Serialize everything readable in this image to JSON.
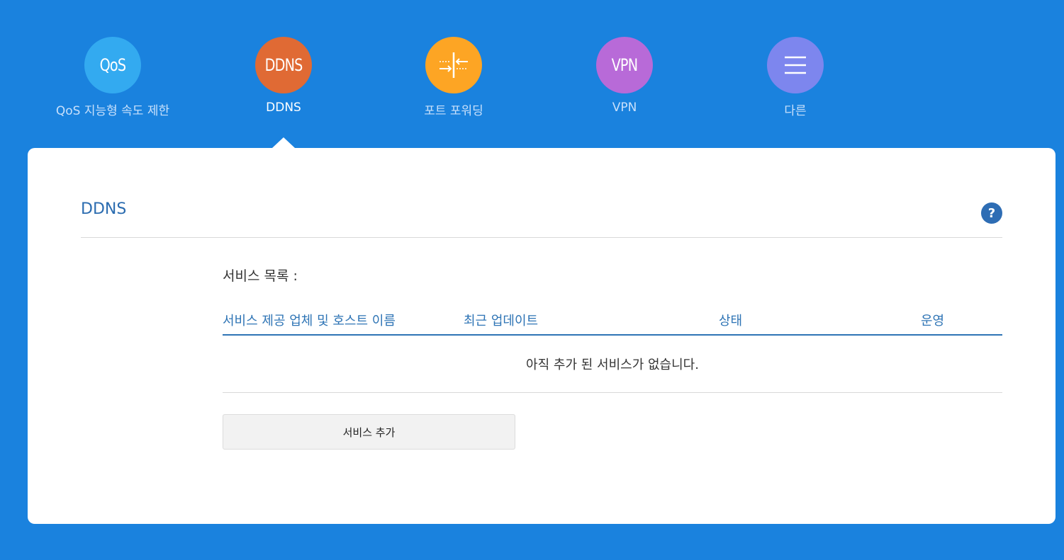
{
  "nav": {
    "items": [
      {
        "icon": "qos-icon",
        "icon_text": "QoS",
        "label": "QoS 지능형 속도 제한",
        "color": "#33aaf0",
        "active": false
      },
      {
        "icon": "ddns-icon",
        "icon_text": "DDNS",
        "label": "DDNS",
        "color": "#e06a34",
        "active": true
      },
      {
        "icon": "port-forwarding-icon",
        "icon_text": "",
        "label": "포트 포워딩",
        "color": "#fda524",
        "active": false
      },
      {
        "icon": "vpn-icon",
        "icon_text": "VPN",
        "label": "VPN",
        "color": "#b86ad8",
        "active": false
      },
      {
        "icon": "menu-icon",
        "icon_text": "",
        "label": "다른",
        "color": "#7d86ee",
        "active": false
      }
    ]
  },
  "panel": {
    "title": "DDNS",
    "help_icon": "?",
    "service_list_label": "서비스 목록 :",
    "table": {
      "headers": [
        "서비스 제공 업체 및 호스트 이름",
        "최근 업데이트",
        "상태",
        "운영"
      ],
      "empty_message": "아직 추가 된 서비스가 없습니다."
    },
    "add_button_label": "서비스 추가"
  },
  "colors": {
    "background": "#1a82de",
    "accent": "#2e74b5",
    "panel": "#ffffff"
  }
}
